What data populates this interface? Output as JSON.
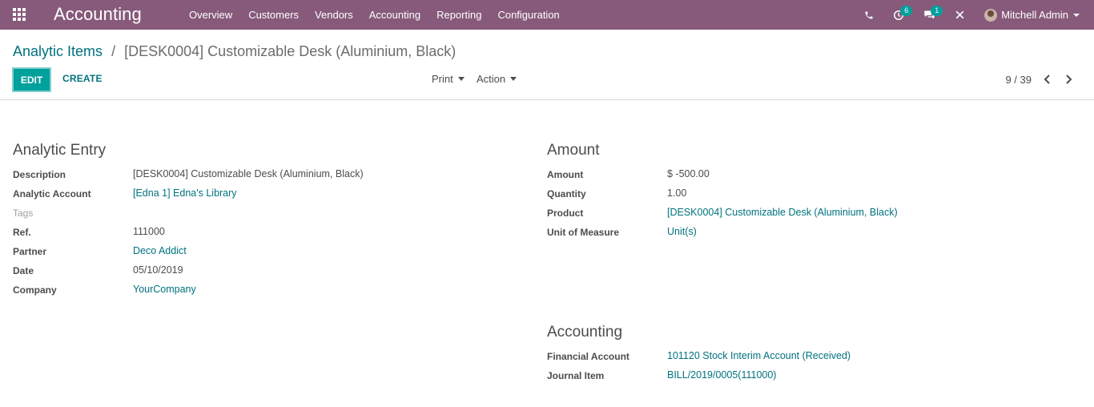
{
  "navbar": {
    "app_title": "Accounting",
    "menu": [
      "Overview",
      "Customers",
      "Vendors",
      "Accounting",
      "Reporting",
      "Configuration"
    ],
    "activity_badge": "6",
    "messages_badge": "1",
    "user_name": "Mitchell Admin"
  },
  "breadcrumb": {
    "parent": "Analytic Items",
    "separator": "/",
    "current": "[DESK0004] Customizable Desk (Aluminium, Black)"
  },
  "toolbar": {
    "edit_label": "EDIT",
    "create_label": "CREATE",
    "print_label": "Print",
    "action_label": "Action",
    "pager_value": "9 / 39"
  },
  "analytic_entry": {
    "title": "Analytic Entry",
    "fields": [
      {
        "label": "Description",
        "value": "[DESK0004] Customizable Desk (Aluminium, Black)"
      },
      {
        "label": "Analytic Account",
        "value": "[Edna 1] Edna's Library"
      },
      {
        "label": "Tags",
        "value": ""
      },
      {
        "label": "Ref.",
        "value": "111000"
      },
      {
        "label": "Partner",
        "value": "Deco Addict"
      },
      {
        "label": "Date",
        "value": "05/10/2019"
      },
      {
        "label": "Company",
        "value": "YourCompany"
      }
    ]
  },
  "amount": {
    "title": "Amount",
    "fields": [
      {
        "label": "Amount",
        "value": "$ -500.00"
      },
      {
        "label": "Quantity",
        "value": "1.00"
      },
      {
        "label": "Product",
        "value": "[DESK0004] Customizable Desk (Aluminium, Black)"
      },
      {
        "label": "Unit of Measure",
        "value": "Unit(s)"
      }
    ]
  },
  "accounting": {
    "title": "Accounting",
    "fields": [
      {
        "label": "Financial Account",
        "value": "101120 Stock Interim Account (Received)"
      },
      {
        "label": "Journal Item",
        "value": "BILL/2019/0005(111000)"
      }
    ]
  },
  "colors": {
    "navbar": "#875a7b",
    "primary": "#00a09d",
    "link": "#00727e"
  }
}
